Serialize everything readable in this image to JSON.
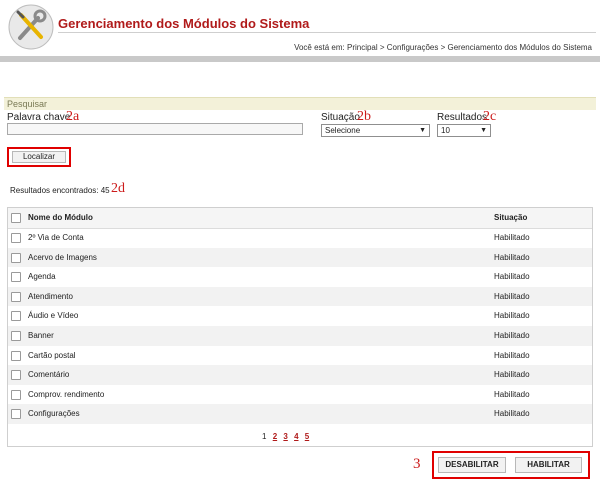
{
  "header": {
    "title": "Gerenciamento dos Módulos do Sistema",
    "breadcrumb": "Você está em: Principal > Configurações > Gerenciamento dos Módulos do Sistema",
    "logo_icon": "tools-wrench-screwdriver-icon"
  },
  "search": {
    "panel_title": "Pesquisar",
    "keyword_label": "Palavra chave",
    "keyword_value": "",
    "status_label": "Situação",
    "status_value": "Selecione",
    "results_label": "Resultados",
    "results_value": "10",
    "search_button": "Localizar"
  },
  "annotations": {
    "a": "2a",
    "b": "2b",
    "c": "2c",
    "d": "2d",
    "three": "3"
  },
  "results": {
    "label": "Resultados encontrados:",
    "count": "45"
  },
  "table": {
    "headers": [
      "Nome do Módulo",
      "Situação"
    ],
    "rows": [
      {
        "name": "2º Via de Conta",
        "status": "Habilitado"
      },
      {
        "name": "Acervo de Imagens",
        "status": "Habilitado"
      },
      {
        "name": "Agenda",
        "status": "Habilitado"
      },
      {
        "name": "Atendimento",
        "status": "Habilitado"
      },
      {
        "name": "Áudio e Vídeo",
        "status": "Habilitado"
      },
      {
        "name": "Banner",
        "status": "Habilitado"
      },
      {
        "name": "Cartão postal",
        "status": "Habilitado"
      },
      {
        "name": "Comentário",
        "status": "Habilitado"
      },
      {
        "name": "Comprov. rendimento",
        "status": "Habilitado"
      },
      {
        "name": "Configurações",
        "status": "Habilitado"
      }
    ]
  },
  "pagination": {
    "current": "1",
    "pages": [
      "2",
      "3",
      "4",
      "5"
    ]
  },
  "actions": {
    "disable": "DESABILITAR",
    "enable": "HABILITAR"
  },
  "colors": {
    "title": "#b01a1a",
    "highlight_border": "#e00000",
    "panel_header": "#f3f1d9"
  }
}
